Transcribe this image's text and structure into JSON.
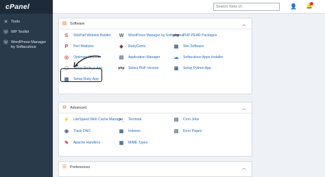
{
  "brand": "cPanel",
  "sidebar": {
    "items": [
      {
        "label": "Tools",
        "icon": "wrench-icon"
      },
      {
        "label": "WP Toolkit",
        "icon": "wordpress-icon"
      },
      {
        "label": "WordPress Manager by Softaculous",
        "icon": "wordpress-icon"
      }
    ]
  },
  "header": {
    "search_placeholder": "Search Tools (/)"
  },
  "software": {
    "title": "Software",
    "tools": [
      {
        "label": "SitePad Website Builder",
        "icon": "sitepad-icon",
        "glyph": "S",
        "color": "#e0383e"
      },
      {
        "label": "WordPress Manager by Softaculous",
        "icon": "wordpress-icon",
        "glyph": "W",
        "color": "#3f5a70"
      },
      {
        "label": "PHP PEAR Packages",
        "icon": "php-icon",
        "glyph": "php",
        "color": "#333333"
      },
      {
        "label": "Perl Modules",
        "icon": "perl-icon",
        "glyph": "P",
        "color": "#c4315a"
      },
      {
        "label": "RubyGems",
        "icon": "rubygems-icon",
        "glyph": "◆",
        "color": "#7a3a50"
      },
      {
        "label": "Site Software",
        "icon": "site-software-icon",
        "glyph": "▦",
        "color": "#4a6b86"
      },
      {
        "label": "Optimize Website",
        "icon": "optimize-icon",
        "glyph": "◎",
        "color": "#d0473a"
      },
      {
        "label": "Application Manager",
        "icon": "application-manager-icon",
        "glyph": "▤",
        "color": "#4a6b86"
      },
      {
        "label": "Softaculous Apps Installer",
        "icon": "softaculous-icon",
        "glyph": "☁",
        "color": "#2a7ad3"
      },
      {
        "label": "Setup Node.js App",
        "icon": "nodejs-icon",
        "glyph": "⬡",
        "color": "#9a9a9a"
      },
      {
        "label": "Select PHP Version",
        "icon": "php-icon",
        "glyph": "php",
        "color": "#333333"
      },
      {
        "label": "Setup Python App",
        "icon": "python-icon",
        "glyph": "▣",
        "color": "#4a6b86"
      },
      {
        "label": "Setup Ruby App",
        "icon": "ruby-icon",
        "glyph": "▦",
        "color": "#4a6b86"
      }
    ]
  },
  "advanced": {
    "title": "Advanced",
    "tools": [
      {
        "label": "LiteSpeed Web Cache Manager",
        "icon": "litespeed-icon",
        "glyph": "⚡",
        "color": "#e3a72c"
      },
      {
        "label": "Terminal",
        "icon": "terminal-icon",
        "glyph": ">_",
        "color": "#4a6b86"
      },
      {
        "label": "Cron Jobs",
        "icon": "cron-icon",
        "glyph": "▤",
        "color": "#4a6b86"
      },
      {
        "label": "Track DNS",
        "icon": "track-dns-icon",
        "glyph": "◉",
        "color": "#4a6b86"
      },
      {
        "label": "Indexes",
        "icon": "indexes-icon",
        "glyph": "▦",
        "color": "#4a6b86"
      },
      {
        "label": "Error Pages",
        "icon": "error-pages-icon",
        "glyph": "▤",
        "color": "#4a6b86"
      },
      {
        "label": "Apache Handlers",
        "icon": "apache-handlers-icon",
        "glyph": "✎",
        "color": "#c43a3a"
      },
      {
        "label": "MIME Types",
        "icon": "mime-types-icon",
        "glyph": "▦",
        "color": "#4a6b86"
      }
    ]
  },
  "preferences": {
    "title": "Preferences"
  }
}
